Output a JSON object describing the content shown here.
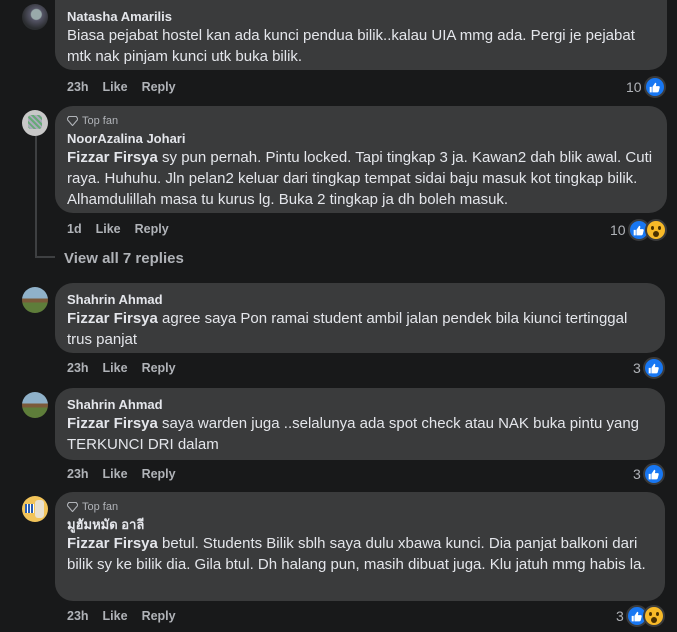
{
  "comments": [
    {
      "name": "Natasha Amarilis",
      "text": "Biasa pejabat hostel kan ada kunci pendua bilik..kalau UIA mmg ada. Pergi je pejabat mtk nak pinjam kunci utk buka bilik.",
      "time": "23h",
      "like": "Like",
      "reply": "Reply",
      "count": "10"
    },
    {
      "badge": "Top fan",
      "name": "NoorAzalina Johari",
      "tag": "Fizzar Firsya",
      "text": " sy pun pernah. Pintu locked. Tapi tingkap 3 ja. Kawan2 dah blik awal. Cuti raya. Huhuhu. Jln pelan2 keluar dari tingkap tempat sidai baju masuk kot tingkap bilik. Alhamdulillah masa tu kurus lg. Buka 2 tingkap ja dh boleh masuk.",
      "time": "1d",
      "like": "Like",
      "reply": "Reply",
      "count": "10"
    },
    {
      "name": "Shahrin Ahmad",
      "tag": "Fizzar Firsya",
      "text": " agree saya Pon ramai student ambil jalan pendek bila kiunci tertinggal trus panjat",
      "time": "23h",
      "like": "Like",
      "reply": "Reply",
      "count": "3"
    },
    {
      "name": "Shahrin Ahmad",
      "tag": "Fizzar Firsya",
      "text": " saya warden juga ..selalunya ada spot check atau NAK buka pintu yang TERKUNCI DRI dalam",
      "time": "23h",
      "like": "Like",
      "reply": "Reply",
      "count": "3"
    },
    {
      "badge": "Top fan",
      "name": "มูฮัมหมัด อาลี",
      "tag": "Fizzar Firsya",
      "text": " betul. Students Bilik sblh saya dulu xbawa kunci. Dia panjat balkoni dari bilik sy ke bilik dia. Gila btul. Dh halang pun, masih dibuat juga. Klu jatuh mmg habis la.",
      "time": "23h",
      "like": "Like",
      "reply": "Reply",
      "count": "3"
    }
  ],
  "view_all": "View all 7 replies",
  "colors": {
    "bg": "#18191a",
    "bubble": "#3a3b3c",
    "like_blue": "#1877f2",
    "wow_yellow": "#f7b928"
  }
}
